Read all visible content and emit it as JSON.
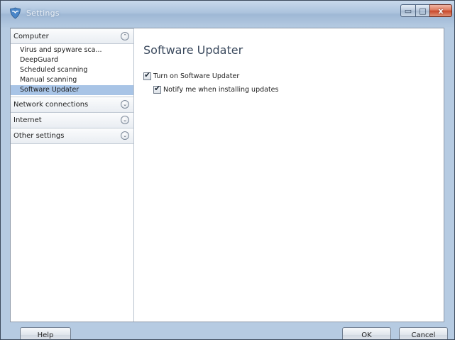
{
  "window": {
    "title": "Settings",
    "minimize_glyph": "▭",
    "maximize_glyph": "□",
    "close_glyph": "x"
  },
  "sidebar": {
    "categories": [
      {
        "label": "Computer",
        "expanded": true,
        "toggle_glyph": "⌃",
        "items": [
          {
            "label": "Virus and spyware sca..."
          },
          {
            "label": "DeepGuard"
          },
          {
            "label": "Scheduled scanning"
          },
          {
            "label": "Manual scanning"
          },
          {
            "label": "Software Updater",
            "selected": true
          }
        ]
      },
      {
        "label": "Network connections",
        "expanded": false,
        "toggle_glyph": "⌄"
      },
      {
        "label": "Internet",
        "expanded": false,
        "toggle_glyph": "⌄"
      },
      {
        "label": "Other settings",
        "expanded": false,
        "toggle_glyph": "⌄"
      }
    ]
  },
  "content": {
    "title": "Software Updater",
    "options": [
      {
        "label": "Turn on Software Updater",
        "checked": true
      },
      {
        "label": "Notify me when installing updates",
        "checked": true
      }
    ],
    "check_glyph": "✔"
  },
  "buttons": {
    "help": "Help",
    "ok": "OK",
    "cancel": "Cancel"
  },
  "colors": {
    "selection": "#a8c4e6",
    "title_text": "#3b4a5e",
    "close_button": "#c8472a"
  }
}
